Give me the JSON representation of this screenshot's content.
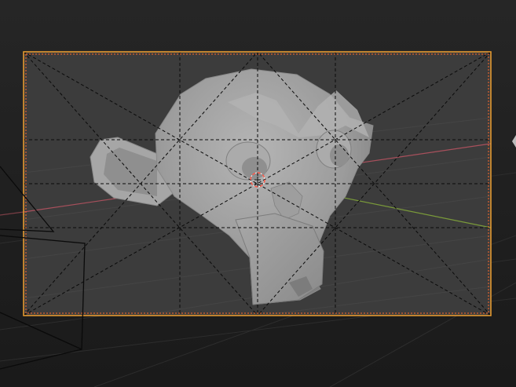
{
  "viewport": {
    "background": "#1d1d1d",
    "frame_fill": "#3a3a3a",
    "frame_border": "#f0a030",
    "frame_border_inner": "#ff6a2a",
    "overlay_color": "#0a0a0a",
    "x_axis_color": "#a8505c",
    "y_axis_color": "#7a9a3a",
    "object_color": "#9a9a9a",
    "origin_color": "#ff5a4a"
  },
  "icons": {
    "camera": "camera-wireframe-icon",
    "origin": "3d-cursor-icon"
  }
}
